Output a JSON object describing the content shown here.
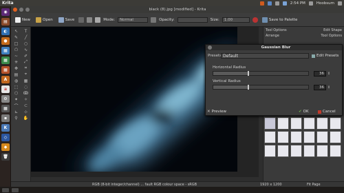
{
  "system": {
    "app_name": "Krita",
    "time": "2:54 PM",
    "user": "Hoobsum"
  },
  "window": {
    "title": "black (8).jpg [modified] - Krita"
  },
  "toolbar": {
    "new_label": "New",
    "open_label": "Open",
    "save_label": "Save",
    "mode_label": "Mode:",
    "mode_value": "Normal",
    "opacity_label": "Opacity:",
    "size_label": "Size:",
    "size_value": "1.00",
    "save_palette_label": "Save to Palette"
  },
  "docker": {
    "tool_options": "Tool Options",
    "edit_shape": "Edit Shape",
    "tool_options_2": "Tool Options",
    "arrange": "Arrange"
  },
  "dialog": {
    "title": "Gaussian Blur",
    "presets_label": "Presets:",
    "presets_value": "Default",
    "edit_presets_label": "Edit Presets",
    "horizontal_label": "Horizontal Radius",
    "horizontal_value": "36",
    "vertical_label": "Vertical Radius",
    "vertical_value": "36",
    "preview_label": "Preview",
    "ok_label": "OK",
    "cancel_label": "Cancel"
  },
  "status": {
    "color_info": "RGB (8-bit integer/channel) ... fault RGB colour space - sRGB",
    "dimensions": "1920 x 1200",
    "zoom": "Fit Page"
  },
  "colors": {
    "accent_orange": "#e2611f",
    "ok_green": "#6ab04c",
    "cancel_red": "#c0392b"
  }
}
